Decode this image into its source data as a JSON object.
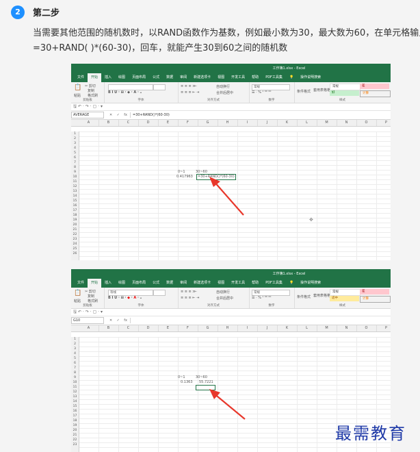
{
  "step": {
    "number": "2",
    "title": "第二步",
    "line1": "当需要其他范围的随机数时，以RAND函数作为基数，例如最小数为30，最大数为60，在单元格输入",
    "line2": "=30+RAND( )*(60-30)，回车，就能产生30到60之间的随机数"
  },
  "excel": {
    "window_title": "工作簿1.xlsx - Excel",
    "tabs": [
      "文件",
      "开始",
      "插入",
      "绘图",
      "页面布局",
      "公式",
      "数据",
      "审阅",
      "新建选项卡",
      "视图",
      "开发工具",
      "帮助",
      "PDF工具集",
      "💡",
      "操作说明搜索"
    ],
    "clipboard": {
      "paste": "粘贴",
      "cut": "✂ 剪切",
      "copy": "复制",
      "format_painter": "格式刷",
      "group": "剪贴板"
    },
    "font_group": "字体",
    "align_group": {
      "wrap": "自动换行",
      "merge": "合并后居中",
      "group": "对齐方式"
    },
    "number_group": "数字",
    "styles_group": {
      "conditional": "条件格式",
      "table": "套用表格格式",
      "group": "样式"
    },
    "columns": [
      "A",
      "B",
      "C",
      "D",
      "E",
      "F",
      "G",
      "H",
      "I",
      "J",
      "K",
      "L",
      "M",
      "N",
      "O",
      "P"
    ],
    "rows": [
      "1",
      "2",
      "3",
      "4",
      "5",
      "6",
      "7",
      "8",
      "9",
      "10",
      "11",
      "12",
      "13",
      "14",
      "15",
      "16",
      "17",
      "18",
      "19",
      "20",
      "21",
      "22",
      "23",
      "24",
      "25",
      "26",
      "27",
      "28",
      "29",
      "30",
      "31",
      "32",
      "33",
      "34",
      "35",
      "36"
    ]
  },
  "shot1": {
    "font_name": "",
    "number_format": "常规",
    "styles": [
      "常规",
      "差",
      "好",
      "计算"
    ],
    "namebox": "AVERAGE",
    "formula": "=30+RAND()*(60-30)",
    "label_a": "0~1",
    "label_b": "30~60",
    "value_a": "0.417963",
    "value_b": "=30+RAND()*(60-30)"
  },
  "shot2": {
    "font_name": "等线",
    "number_format": "常规",
    "styles": [
      "常规",
      "差",
      "适中",
      "计算"
    ],
    "namebox": "G10",
    "formula": "",
    "label_a": "0~1",
    "label_b": "30~60",
    "value_a": "0.1363",
    "value_b": "55.7221"
  },
  "watermark": "最需教育",
  "colors": {
    "excel_green": "#217346",
    "badge_blue": "#1e90ff",
    "arrow_red": "#e8372b",
    "watermark": "#1f3aa8"
  }
}
